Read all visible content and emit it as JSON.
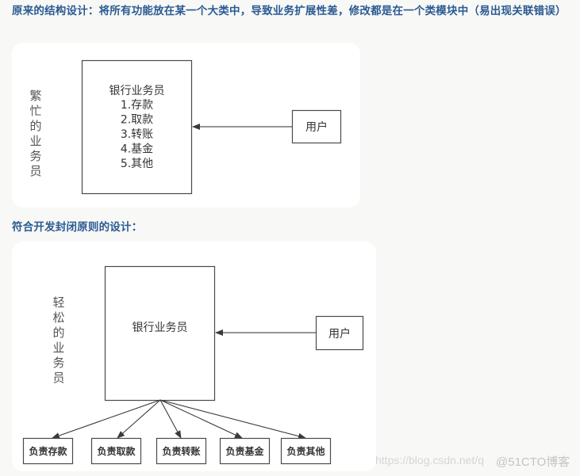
{
  "headings": {
    "original": "原来的结构设计：将所有功能放在某一个大类中，导致业务扩展性差，修改都是在一个类模块中（易出现关联错误）",
    "open_closed": "符合开发封闭原则的设计："
  },
  "diagram1": {
    "side_label": "繁忙的业务员",
    "main_box": {
      "title": "银行业务员",
      "items": [
        "1.存款",
        "2.取款",
        "3.转账",
        "4.基金",
        "5.其他"
      ]
    },
    "user_box": "用户"
  },
  "diagram2": {
    "side_label": "轻松的业务员",
    "main_box": {
      "title": "银行业务员"
    },
    "user_box": "用户",
    "children": [
      "负责存款",
      "负责取款",
      "负责转账",
      "负责基金",
      "负责其他"
    ]
  },
  "watermarks": {
    "csdn": "https://blog.csdn.net/q",
    "cto": "@51CTO博客"
  },
  "colors": {
    "heading": "#2a5a92",
    "line": "#4a4a4a"
  }
}
